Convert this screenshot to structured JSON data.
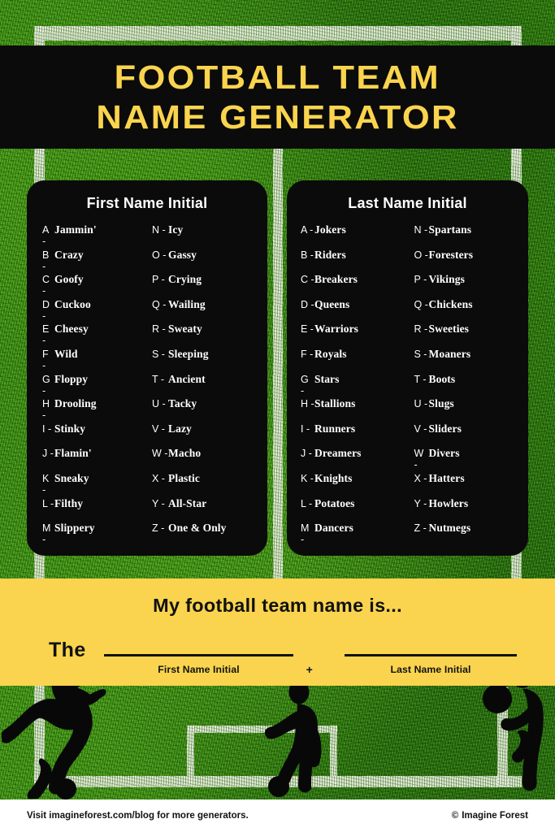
{
  "title": {
    "line1": "FOOTBALL TEAM",
    "line2": "NAME GENERATOR"
  },
  "colors": {
    "yellow": "#FAD44E",
    "black": "#0B0B0B",
    "grass_green": "#3D940F",
    "line_white": "#E8EEDE"
  },
  "cards": [
    {
      "id": "first-name-initial",
      "title": "First Name Initial",
      "columns": [
        [
          {
            "letter": "A -",
            "word": "Jammin'"
          },
          {
            "letter": "B -",
            "word": "Crazy"
          },
          {
            "letter": "C -",
            "word": "Goofy"
          },
          {
            "letter": "D -",
            "word": "Cuckoo"
          },
          {
            "letter": "E -",
            "word": "Cheesy"
          },
          {
            "letter": "F -",
            "word": "Wild"
          },
          {
            "letter": "G -",
            "word": "Floppy"
          },
          {
            "letter": "H -",
            "word": "Drooling"
          },
          {
            "letter": "I -",
            "word": "Stinky"
          },
          {
            "letter": "J -",
            "word": "Flamin'"
          },
          {
            "letter": "K -",
            "word": "Sneaky"
          },
          {
            "letter": "L -",
            "word": "Filthy"
          },
          {
            "letter": "M -",
            "word": "Slippery"
          }
        ],
        [
          {
            "letter": "N -",
            "word": "Icy"
          },
          {
            "letter": "O -",
            "word": "Gassy"
          },
          {
            "letter": "P -",
            "word": "Crying"
          },
          {
            "letter": "Q -",
            "word": "Wailing"
          },
          {
            "letter": "R -",
            "word": "Sweaty"
          },
          {
            "letter": "S -",
            "word": "Sleeping"
          },
          {
            "letter": "T -",
            "word": "Ancient"
          },
          {
            "letter": "U -",
            "word": "Tacky"
          },
          {
            "letter": "V -",
            "word": "Lazy"
          },
          {
            "letter": "W -",
            "word": "Macho"
          },
          {
            "letter": "X -",
            "word": "Plastic"
          },
          {
            "letter": "Y -",
            "word": "All-Star"
          },
          {
            "letter": "Z -",
            "word": "One & Only"
          }
        ]
      ]
    },
    {
      "id": "last-name-initial",
      "title": "Last Name Initial",
      "columns": [
        [
          {
            "letter": "A -",
            "word": "Jokers"
          },
          {
            "letter": "B -",
            "word": "Riders"
          },
          {
            "letter": "C -",
            "word": "Breakers"
          },
          {
            "letter": "D -",
            "word": "Queens"
          },
          {
            "letter": "E -",
            "word": "Warriors"
          },
          {
            "letter": "F -",
            "word": "Royals"
          },
          {
            "letter": "G -",
            "word": "Stars"
          },
          {
            "letter": "H -",
            "word": "Stallions"
          },
          {
            "letter": "I -",
            "word": "Runners"
          },
          {
            "letter": "J -",
            "word": "Dreamers"
          },
          {
            "letter": "K -",
            "word": "Knights"
          },
          {
            "letter": "L -",
            "word": "Potatoes"
          },
          {
            "letter": "M -",
            "word": "Dancers"
          }
        ],
        [
          {
            "letter": "N -",
            "word": "Spartans"
          },
          {
            "letter": "O -",
            "word": "Foresters"
          },
          {
            "letter": "P -",
            "word": "Vikings"
          },
          {
            "letter": "Q -",
            "word": "Chickens"
          },
          {
            "letter": "R -",
            "word": "Sweeties"
          },
          {
            "letter": "S -",
            "word": "Moaners"
          },
          {
            "letter": "T -",
            "word": "Boots"
          },
          {
            "letter": "U -",
            "word": "Slugs"
          },
          {
            "letter": "V -",
            "word": "Sliders"
          },
          {
            "letter": "W -",
            "word": "Divers"
          },
          {
            "letter": "X -",
            "word": "Hatters"
          },
          {
            "letter": "Y -",
            "word": "Howlers"
          },
          {
            "letter": "Z -",
            "word": "Nutmegs"
          }
        ]
      ]
    }
  ],
  "form": {
    "heading": "My football team name is...",
    "the_word": "The",
    "first_blank_label": "First Name Initial",
    "plus": "+",
    "last_blank_label": "Last Name Initial"
  },
  "footer": {
    "visit_text": "Visit imagineforest.com/blog for more generators.",
    "copyright_symbol": "©",
    "brand": "Imagine Forest"
  }
}
